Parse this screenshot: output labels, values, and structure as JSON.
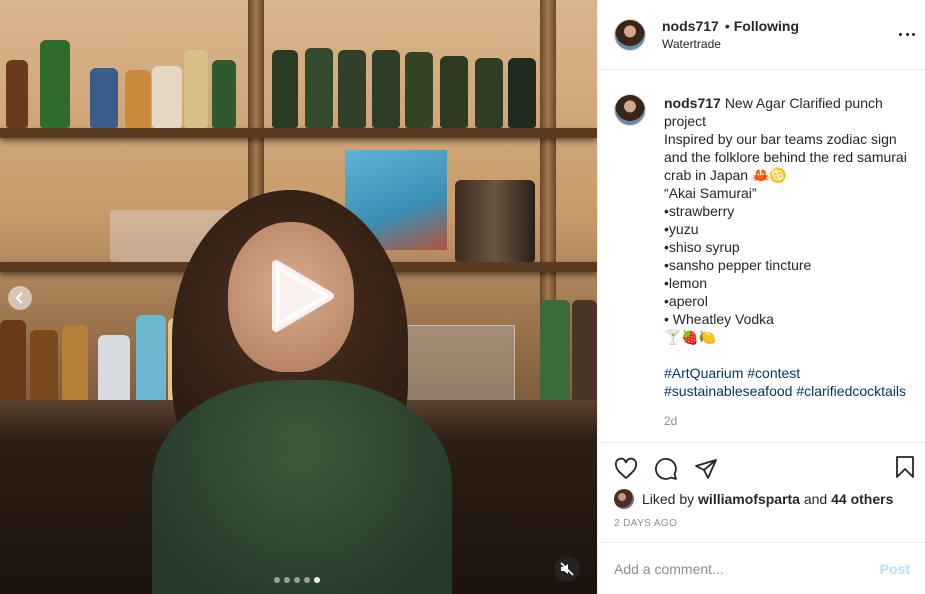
{
  "post": {
    "username": "nods717",
    "follow_separator": "•",
    "follow_status": "Following",
    "location": "Watertrade"
  },
  "caption": {
    "username": "nods717",
    "lines": [
      "New Agar Clarified punch project",
      "Inspired by our bar teams zodiac sign and the folklore behind the red samurai crab in Japan 🦀♋",
      "“Akai Samurai”",
      "•strawberry",
      "•yuzu",
      "•shiso syrup",
      "•sansho pepper tincture",
      "•lemon",
      "•aperol",
      "• Wheatley Vodka",
      "🍸🍓🍋"
    ],
    "hashtags": [
      "#ArtQuarium",
      "#contest",
      "#sustainableseafood",
      "#clarifiedcocktails"
    ],
    "time": "2d"
  },
  "likes": {
    "prefix": "Liked by",
    "user": "williamofsparta",
    "conjunction": "and",
    "others": "44 others",
    "date": "2 DAYS AGO"
  },
  "comment": {
    "placeholder": "Add a comment...",
    "post_label": "Post"
  },
  "media": {
    "type": "video",
    "muted": true,
    "carousel_total": 5,
    "carousel_active": 5
  },
  "icons": {
    "play": "play-icon",
    "prev": "chevron-left-icon",
    "mute": "muted-speaker-icon",
    "more": "more-options-icon",
    "like": "heart-icon",
    "comment": "comment-bubble-icon",
    "share": "paper-plane-icon",
    "save": "bookmark-icon"
  },
  "colors": {
    "link": "#00376b",
    "muted_text": "#8e8e8e",
    "post_button_disabled": "#b2dffc"
  }
}
